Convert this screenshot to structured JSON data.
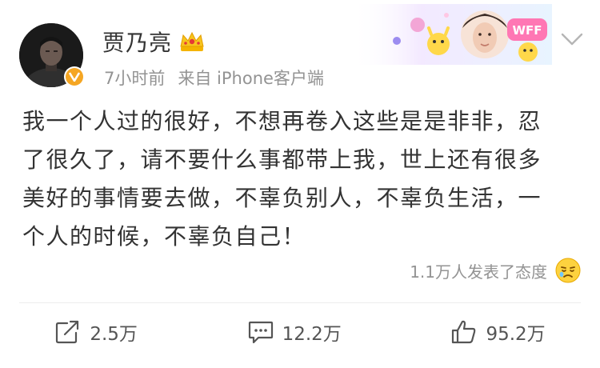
{
  "author": {
    "name": "贾乃亮",
    "avatar_icon": "avatar-photo",
    "badge_icon": "verified-v-icon",
    "crown_icon": "crown-icon"
  },
  "meta": {
    "time": "7小时前",
    "source": "来自 iPhone客户端"
  },
  "post": {
    "lines": [
      "我一个人过的很好，不想再卷入这些是是非非，忍",
      "了很久了，请不要什么事都带上我，世上还有很多",
      "美好的事情要去做，不辜负别人，不辜负生活，一",
      "个人的时候，不辜负自己！"
    ]
  },
  "reactions": {
    "text": "1.1万人发表了态度",
    "icon": "sad-face-icon"
  },
  "actions": {
    "repost": {
      "count": "2.5万",
      "icon": "repost-icon"
    },
    "comment": {
      "count": "12.2万",
      "icon": "comment-icon"
    },
    "like": {
      "count": "95.2万",
      "icon": "thumbs-up-icon"
    }
  },
  "colors": {
    "text": "#333333",
    "meta": "#939393",
    "badge": "#f5a623",
    "divider": "#ececec"
  }
}
